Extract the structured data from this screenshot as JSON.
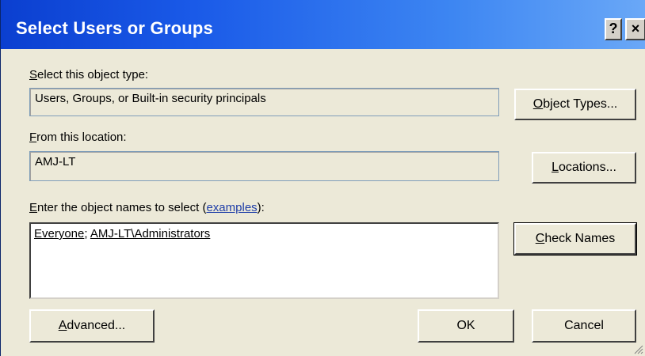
{
  "window": {
    "title": "Select Users or Groups",
    "help_btn": "?",
    "close_btn": "×"
  },
  "object_type": {
    "label_u": "S",
    "label_rest": "elect this object type:",
    "value": "Users, Groups, or Built-in security principals",
    "button_u": "O",
    "button_rest": "bject Types..."
  },
  "location": {
    "label_u": "F",
    "label_rest": "rom this location:",
    "value": "AMJ-LT",
    "button_u": "L",
    "button_rest": "ocations..."
  },
  "names": {
    "label_u": "E",
    "label_rest": "nter the object names to select (",
    "link": "examples",
    "label_end": "):",
    "entries": [
      "Everyone",
      "AMJ-LT\\Administrators"
    ],
    "separator": "; ",
    "check_u": "C",
    "check_rest": "heck Names"
  },
  "footer": {
    "advanced_u": "A",
    "advanced_rest": "dvanced...",
    "ok": "OK",
    "cancel": "Cancel"
  }
}
